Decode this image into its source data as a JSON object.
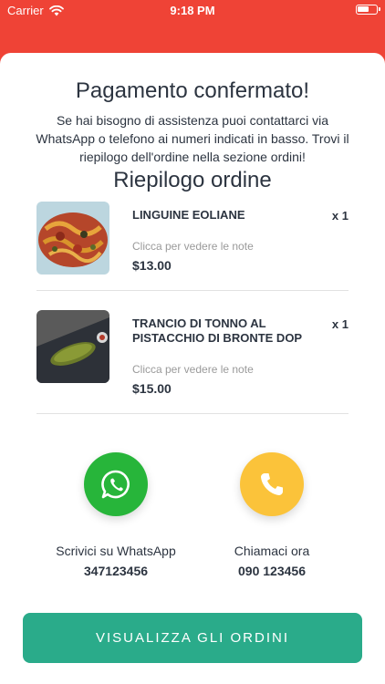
{
  "status_bar": {
    "carrier": "Carrier",
    "time": "9:18 PM"
  },
  "confirmation": {
    "title": "Pagamento confermato!",
    "message": "Se hai bisogno di assistenza puoi contattarci via WhatsApp o telefono ai numeri indicati in basso. Trovi il riepilogo dell'ordine nella sezione ordini!"
  },
  "summary": {
    "title": "Riepilogo ordine",
    "items": [
      {
        "name": "LINGUINE EOLIANE",
        "qty": "x 1",
        "note": "Clicca per vedere le note",
        "price": "$13.00"
      },
      {
        "name": "TRANCIO DI TONNO AL PISTACCHIO DI BRONTE DOP",
        "qty": "x 1",
        "note": "Clicca per vedere le note",
        "price": "$15.00"
      }
    ]
  },
  "contacts": {
    "whatsapp": {
      "label": "Scrivici su WhatsApp",
      "number": "347123456",
      "icon": "whatsapp-icon",
      "color": "#27b53a"
    },
    "phone": {
      "label": "Chiamaci ora",
      "number": "090 123456",
      "icon": "phone-icon",
      "color": "#fbc33a"
    }
  },
  "cta": {
    "label": "VISUALIZZA GLI ORDINI",
    "color": "#2aab8a"
  },
  "colors": {
    "header": "#ef4336",
    "text": "#2c3440",
    "muted": "#9a9a9a"
  }
}
